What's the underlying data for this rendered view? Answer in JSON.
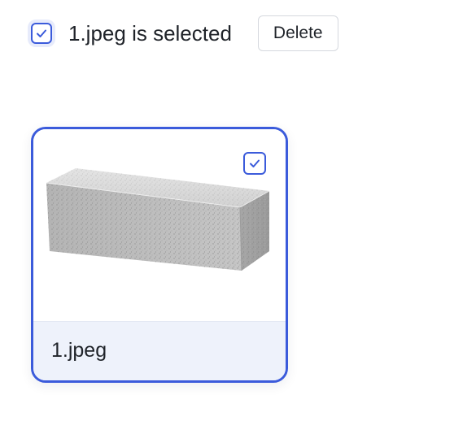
{
  "toolbar": {
    "select_all_checked": true,
    "selection_text": "1.jpeg is selected",
    "delete_label": "Delete"
  },
  "files": [
    {
      "name": "1.jpeg",
      "selected": true,
      "thumbnail": "grey-concrete-block-image"
    }
  ],
  "colors": {
    "accent": "#3b5bdb",
    "footer_bg": "#eef2fb",
    "text": "#1f2329",
    "button_border": "#d5d8de"
  }
}
